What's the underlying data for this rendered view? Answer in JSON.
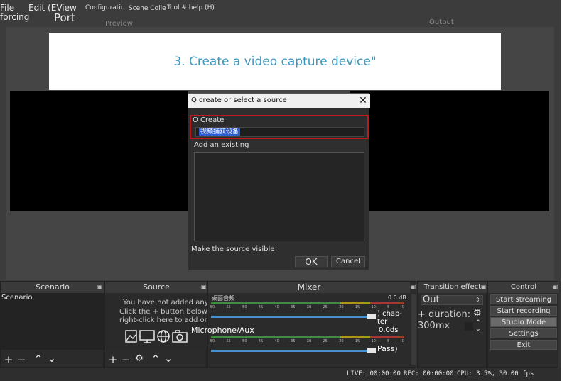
{
  "menu": {
    "file": "File",
    "forcing": "forcing",
    "edit_view": "Edit (EView",
    "port": "Port",
    "configuration": "Configuratic",
    "scene_collection": "Scene Colle",
    "tools_help": "Tool # help (H)"
  },
  "preview": {
    "label": "Preview"
  },
  "output": {
    "label": "Output"
  },
  "banner": {
    "text": "3. Create a video capture device\""
  },
  "dialog": {
    "title": "Q create or select a source",
    "close": "✕",
    "create_label": "O Create",
    "name_value": "视频捕获设备",
    "add_existing_label": "Add an existing",
    "make_visible_label": "Make the source visible",
    "ok_label": "OK",
    "cancel_label": "Cancel"
  },
  "docks": {
    "scenario": {
      "title": "Scenario",
      "items": [
        "Scenario"
      ]
    },
    "source": {
      "title": "Source",
      "empty_line1": "You have not added any source yet.",
      "empty_line2": "Click the + button below, or",
      "empty_line3": "right-click here to add one."
    },
    "mixer": {
      "title": "Mixer",
      "channel1_name": "桌面音频",
      "channel1_db": "0.0 dB",
      "channel2_name": "Microphone/Aux",
      "channel2_db": "0.0ds",
      "chapter_label": ") chap-ter",
      "pass_label": "Pass)",
      "ticks": [
        "-60",
        "-55",
        "-50",
        "-45",
        "-40",
        "-35",
        "-30",
        "-25",
        "-20",
        "-15",
        "-10",
        "-5",
        "0"
      ]
    },
    "transition": {
      "title": "Transition effect",
      "selected": "Out",
      "duration_label": "+ duration:",
      "duration_value": "300mx"
    },
    "control": {
      "title": "Control",
      "start_streaming": "Start streaming",
      "start_recording": "Start recording",
      "studio_mode": "Studio Mode",
      "settings": "Settings",
      "exit": "Exit"
    }
  },
  "status": {
    "live": "LIVE: 00:00:00",
    "rec": "REC: 00:00:00",
    "cpu": "CPU: 3.5%, 30.00 fps"
  },
  "colors": {
    "accent_red": "#c0161d",
    "banner_text": "#3e95be",
    "meter_green": "#4caf50",
    "meter_yellow": "#c8b400",
    "meter_red": "#c0392b",
    "fader_blue": "#4a8fd4"
  }
}
